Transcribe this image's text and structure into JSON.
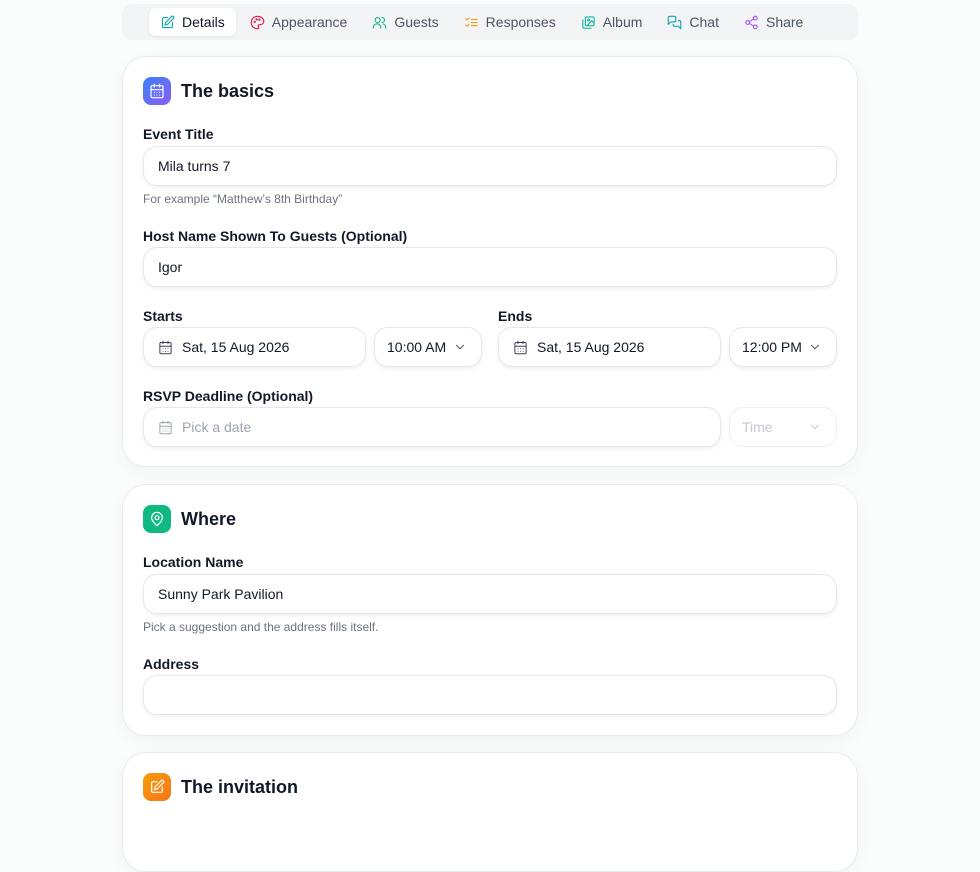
{
  "tabs": [
    {
      "label": "Details",
      "icon": "edit-icon",
      "color": "#0ea5b7",
      "active": true
    },
    {
      "label": "Appearance",
      "icon": "palette-icon",
      "color": "#e11d48"
    },
    {
      "label": "Guests",
      "icon": "users-icon",
      "color": "#10b981"
    },
    {
      "label": "Responses",
      "icon": "list-checks-icon",
      "color": "#f59e0b"
    },
    {
      "label": "Album",
      "icon": "images-icon",
      "color": "#14b8a6"
    },
    {
      "label": "Chat",
      "icon": "chat-icon",
      "color": "#0ea5b7"
    },
    {
      "label": "Share",
      "icon": "share-icon",
      "color": "#a855f7"
    }
  ],
  "basics": {
    "title": "The basics",
    "icon": "calendar-icon",
    "event_title_label": "Event Title",
    "event_title_value": "Mila turns 7",
    "event_title_hint": "For example “Matthew’s 8th Birthday”",
    "host_label": "Host Name Shown To Guests (Optional)",
    "host_value": "Igor",
    "starts_label": "Starts",
    "starts_date": "Sat, 15 Aug 2026",
    "starts_time": "10:00 AM",
    "ends_label": "Ends",
    "ends_date": "Sat, 15 Aug 2026",
    "ends_time": "12:00 PM",
    "rsvp_label": "RSVP Deadline (Optional)",
    "rsvp_date_placeholder": "Pick a date",
    "rsvp_time_placeholder": "Time"
  },
  "where": {
    "title": "Where",
    "icon": "map-pin-icon",
    "location_label": "Location Name",
    "location_value": "Sunny Park Pavilion",
    "location_hint": "Pick a suggestion and the address fills itself.",
    "address_label": "Address",
    "address_value": ""
  },
  "invitation": {
    "title": "The invitation",
    "icon": "note-icon"
  },
  "colors": {
    "basics_badge": "#4f7cf7",
    "where_badge": "#10b981",
    "invitation_badge": "#f97316"
  }
}
